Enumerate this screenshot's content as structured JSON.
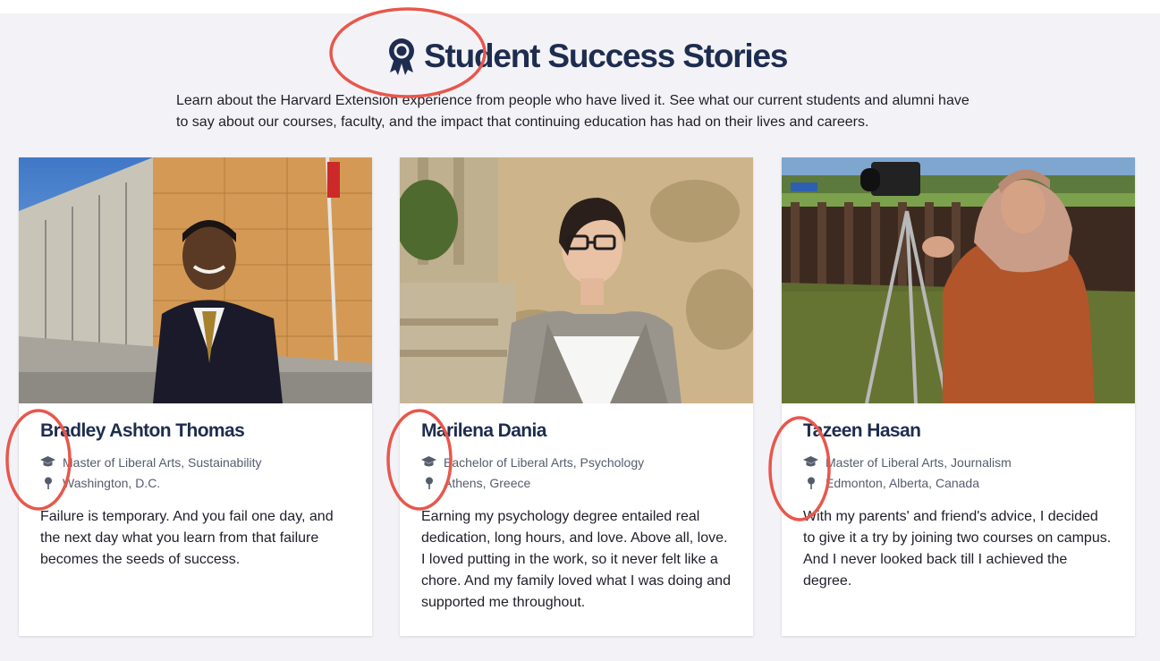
{
  "page": {
    "title": "Student Success Stories",
    "title_icon": "award-ribbon-icon",
    "intro": "Learn about the Harvard Extension experience from people who have lived it. See what our current students and alumni have to say about our courses, faculty, and the impact that continuing education has had on their lives and careers."
  },
  "stories": [
    {
      "name": "Bradley Ashton Thomas",
      "degree": "Master of Liberal Arts, Sustainability",
      "location": "Washington, D.C.",
      "quote": "Failure is temporary. And you fail one day, and the next day what you learn from that failure becomes the seeds of success."
    },
    {
      "name": "Marilena Dania",
      "degree": "Bachelor of Liberal Arts, Psychology",
      "location": "Athens, Greece",
      "quote": "Earning my psychology degree entailed real dedication, long hours, and love. Above all, love. I loved putting in the work, so it never felt like a chore. And my family loved what I was doing and supported me throughout."
    },
    {
      "name": "Tazeen Hasan",
      "degree": "Master of Liberal Arts, Journalism",
      "location": "Edmonton, Alberta, Canada",
      "quote": "With my parents' and friend's advice, I decided to give it a try by joining two courses on campus. And I never looked back till I achieved the degree."
    }
  ],
  "icons": {
    "degree": "graduation-cap-icon",
    "location": "map-pin-icon"
  },
  "colors": {
    "background": "#f3f3f7",
    "heading": "#1e2d4f",
    "meta_text": "#555c6c",
    "annotation": "#e8574c"
  }
}
